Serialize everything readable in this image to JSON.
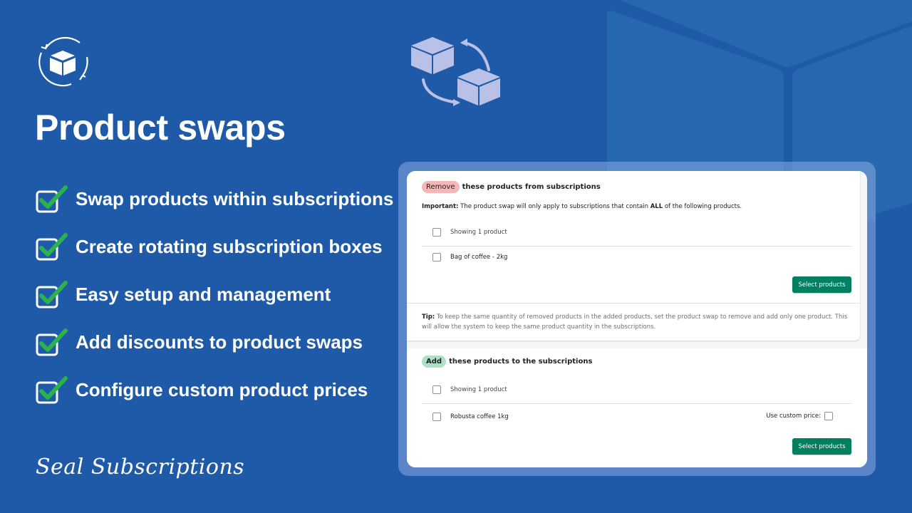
{
  "title": "Product swaps",
  "features": [
    "Swap products within subscriptions",
    "Create rotating subscription boxes",
    "Easy setup and management",
    "Add discounts to product swaps",
    "Configure custom product prices"
  ],
  "brand": "Seal Subscriptions",
  "icons": {
    "logo": "rotating-box-icon",
    "art": "box-swap-icon",
    "feature": "checkbox-checked-icon"
  },
  "colors": {
    "background": "#1e5aa8",
    "check_green": "#2bb24c",
    "button_green": "#008060",
    "remove_pill": "#f4b7b5",
    "add_pill": "#aee0c6"
  },
  "remove_section": {
    "pill": "Remove",
    "heading": "these products from subscriptions",
    "important_label": "Important:",
    "important_text_1": "The product swap will only apply to subscriptions that contain",
    "important_bold": "ALL",
    "important_text_2": "of the following products.",
    "showing": "Showing 1 product",
    "products": [
      "Bag of coffee - 2kg"
    ],
    "button": "Select products"
  },
  "tip": {
    "label": "Tip:",
    "text": "To keep the same quantity of removed products in the added products, set the product swap to remove and add only one product. This will allow the system to keep the same product quantity in the subscriptions."
  },
  "add_section": {
    "pill": "Add",
    "heading": "these products to the subscriptions",
    "showing": "Showing 1 product",
    "products": [
      "Robusta coffee 1kg"
    ],
    "custom_price_label": "Use custom price:",
    "button": "Select products"
  }
}
